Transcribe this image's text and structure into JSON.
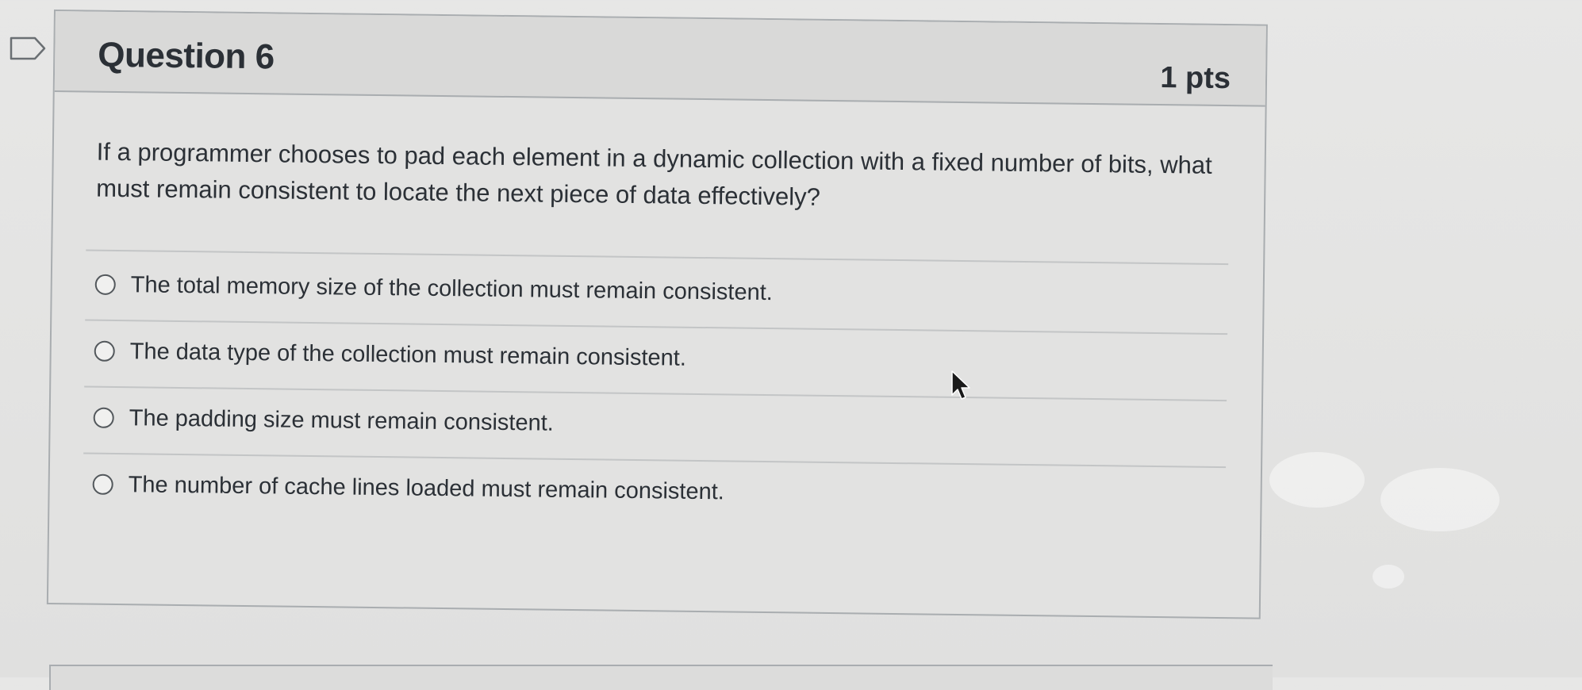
{
  "question": {
    "title": "Question 6",
    "points": "1 pts",
    "text": "If a programmer chooses to pad each element in a dynamic collection with a fixed number of bits, what must remain consistent to locate the next piece of data effectively?"
  },
  "answers": [
    {
      "label": "The total memory size of the collection must remain consistent."
    },
    {
      "label": "The data type of the collection must remain consistent."
    },
    {
      "label": "The padding size must remain consistent."
    },
    {
      "label": "The number of cache lines loaded must remain consistent."
    }
  ],
  "icons": {
    "flag": "bookmark-flag-icon",
    "cursor": "mouse-pointer-icon",
    "radio": "radio-button-icon"
  },
  "colors": {
    "text": "#2b3036",
    "border": "#a9adb0",
    "header_bg": "#d9d9d8",
    "card_bg": "#e2e2e1"
  }
}
